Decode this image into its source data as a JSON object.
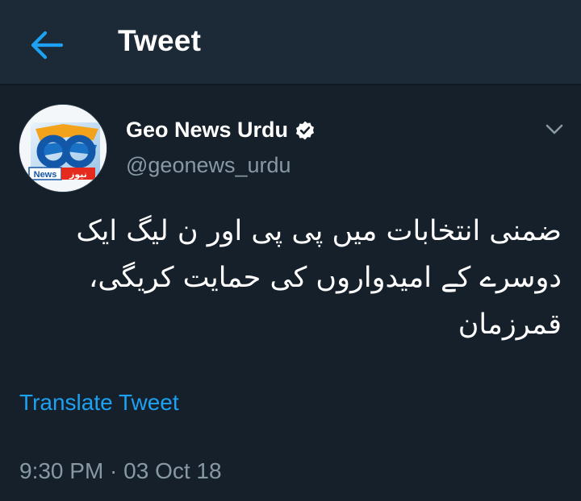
{
  "header": {
    "title": "Tweet",
    "back_icon": "arrow-left-icon"
  },
  "colors": {
    "background": "#15202b",
    "header_background": "#1c2a38",
    "accent": "#1da1f2",
    "secondary_text": "#8899a6"
  },
  "tweet": {
    "display_name": "Geo News Urdu",
    "verified": true,
    "handle": "@geonews_urdu",
    "avatar_label_left": "News",
    "avatar_label_right": "نیوز",
    "text_lines": [
      "ضمنی انتخابات میں پی پی اور ن لیگ ایک",
      "دوسرے کے امیدواروں کی حمایت کریگی،",
      "قمرزمان"
    ],
    "translate_label": "Translate Tweet",
    "timestamp": "9:30 PM · 03 Oct 18"
  }
}
